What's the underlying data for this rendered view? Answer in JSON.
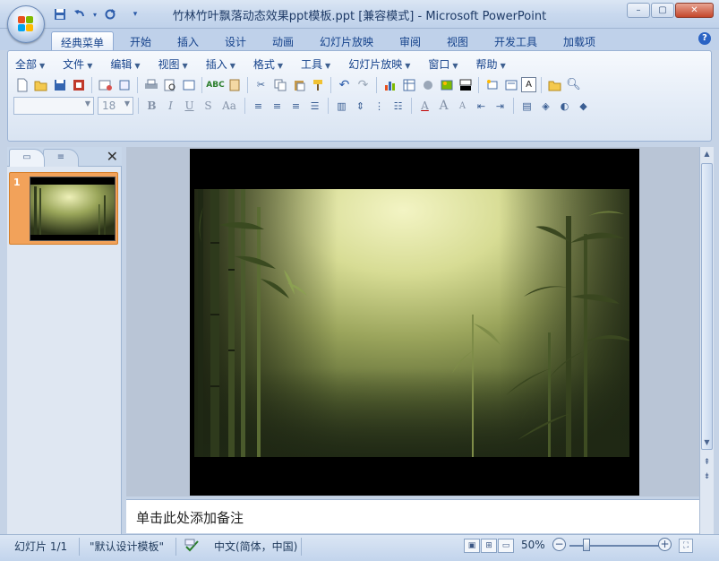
{
  "window": {
    "title": "竹林竹叶飘落动态效果ppt模板.ppt [兼容模式] - Microsoft PowerPoint",
    "controls": {
      "minimize": "–",
      "maximize": "▢",
      "close": "✕"
    }
  },
  "quick_access": {
    "save_icon": "save-icon",
    "undo_icon": "undo-icon",
    "redo_icon": "redo-icon",
    "customize": "▾"
  },
  "ribbon_tabs": [
    "经典菜单",
    "开始",
    "插入",
    "设计",
    "动画",
    "幻灯片放映",
    "审阅",
    "视图",
    "开发工具",
    "加载项"
  ],
  "help": "?",
  "classic_menu": [
    {
      "label": "全部"
    },
    {
      "label": "文件"
    },
    {
      "label": "编辑"
    },
    {
      "label": "视图"
    },
    {
      "label": "插入"
    },
    {
      "label": "格式"
    },
    {
      "label": "工具"
    },
    {
      "label": "幻灯片放映"
    },
    {
      "label": "窗口"
    },
    {
      "label": "帮助"
    }
  ],
  "font": {
    "name": "",
    "size": "18"
  },
  "format_buttons": {
    "bold": "B",
    "italic": "I",
    "underline": "U",
    "shadow": "S",
    "case": "Aa",
    "font_color": "A",
    "grow": "A",
    "shrink": "A"
  },
  "slides_panel": {
    "tab_slides": "▭",
    "tab_outline": "≡",
    "close": "✕",
    "slide_number": "1"
  },
  "notes": {
    "placeholder": "单击此处添加备注"
  },
  "status": {
    "slide_info": "幻灯片 1/1",
    "theme": "\"默认设计模板\"",
    "language": "中文(简体，中国)",
    "zoom": "50%",
    "zoom_level": 0.5
  },
  "colors": {
    "accent": "#15428b",
    "selected_thumb": "#f2a25a",
    "ribbon_border": "#9ab2d4"
  }
}
